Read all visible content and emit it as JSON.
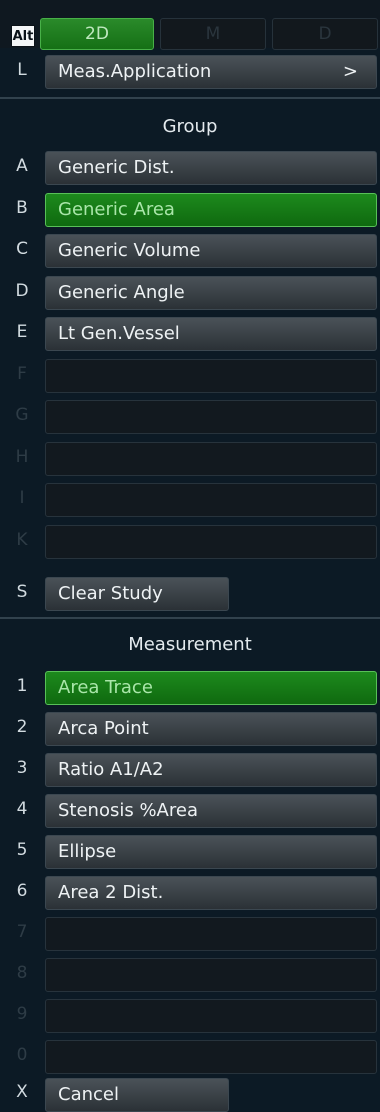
{
  "top": {
    "alt_label": "Alt",
    "modes": [
      {
        "label": "2D",
        "active": true
      },
      {
        "label": "M",
        "active": false
      },
      {
        "label": "D",
        "active": false
      }
    ]
  },
  "app_row": {
    "letter": "L",
    "label": "Meas.Application",
    "chevron": ">"
  },
  "group": {
    "header": "Group",
    "items": [
      {
        "letter": "A",
        "label": "Generic Dist."
      },
      {
        "letter": "B",
        "label": "Generic Area",
        "selected": true
      },
      {
        "letter": "C",
        "label": "Generic Volume"
      },
      {
        "letter": "D",
        "label": "Generic Angle"
      },
      {
        "letter": "E",
        "label": "Lt Gen.Vessel"
      },
      {
        "letter": "F",
        "label": ""
      },
      {
        "letter": "G",
        "label": ""
      },
      {
        "letter": "H",
        "label": ""
      },
      {
        "letter": "I",
        "label": ""
      },
      {
        "letter": "K",
        "label": ""
      }
    ],
    "clear": {
      "letter": "S",
      "label": "Clear Study"
    }
  },
  "measurement": {
    "header": "Measurement",
    "items": [
      {
        "letter": "1",
        "label": "Area Trace",
        "selected": true
      },
      {
        "letter": "2",
        "label": "Arca Point"
      },
      {
        "letter": "3",
        "label": "Ratio A1/A2"
      },
      {
        "letter": "4",
        "label": "Stenosis %Area"
      },
      {
        "letter": "5",
        "label": "Ellipse"
      },
      {
        "letter": "6",
        "label": "Area 2 Dist."
      },
      {
        "letter": "7",
        "label": ""
      },
      {
        "letter": "8",
        "label": ""
      },
      {
        "letter": "9",
        "label": ""
      },
      {
        "letter": "0",
        "label": ""
      }
    ],
    "cancel": {
      "letter": "X",
      "label": "Cancel"
    }
  },
  "colors": {
    "selected": "#1d8a1d",
    "button": "#3a4248",
    "background": "#0c1a25"
  }
}
